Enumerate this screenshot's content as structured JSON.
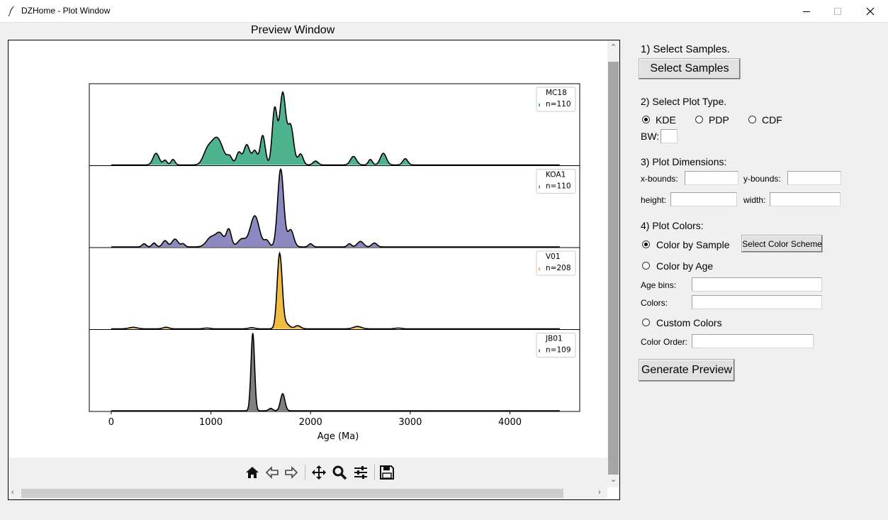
{
  "window": {
    "title": "DZHome - Plot Window"
  },
  "preview": {
    "label": "Preview Window"
  },
  "chart_data": {
    "type": "area",
    "xlabel": "Age (Ma)",
    "xlim": [
      -220,
      4700
    ],
    "xticks": [
      0,
      1000,
      2000,
      3000,
      4000
    ],
    "x_range": [
      0,
      4500
    ],
    "series": [
      {
        "name": "MC18",
        "n_label": "n=110",
        "color": "#4db38e",
        "peaks": [
          [
            450,
            0.15,
            30
          ],
          [
            540,
            0.06,
            20
          ],
          [
            620,
            0.07,
            20
          ],
          [
            960,
            0.14,
            40
          ],
          [
            1060,
            0.35,
            60
          ],
          [
            1190,
            0.09,
            25
          ],
          [
            1280,
            0.16,
            25
          ],
          [
            1360,
            0.26,
            30
          ],
          [
            1440,
            0.18,
            25
          ],
          [
            1520,
            0.38,
            25
          ],
          [
            1640,
            0.72,
            25
          ],
          [
            1720,
            0.92,
            30
          ],
          [
            1800,
            0.5,
            30
          ],
          [
            1900,
            0.14,
            25
          ],
          [
            2050,
            0.05,
            25
          ],
          [
            2430,
            0.11,
            30
          ],
          [
            2600,
            0.07,
            20
          ],
          [
            2730,
            0.15,
            30
          ],
          [
            2950,
            0.08,
            25
          ]
        ]
      },
      {
        "name": "KOA1",
        "n_label": "n=110",
        "color": "#8c89c0",
        "peaks": [
          [
            330,
            0.04,
            20
          ],
          [
            430,
            0.05,
            20
          ],
          [
            540,
            0.08,
            25
          ],
          [
            640,
            0.1,
            30
          ],
          [
            720,
            0.04,
            20
          ],
          [
            1000,
            0.12,
            45
          ],
          [
            1090,
            0.17,
            40
          ],
          [
            1180,
            0.22,
            25
          ],
          [
            1310,
            0.1,
            40
          ],
          [
            1440,
            0.4,
            45
          ],
          [
            1560,
            0.08,
            25
          ],
          [
            1700,
            1.0,
            30
          ],
          [
            1800,
            0.22,
            30
          ],
          [
            2000,
            0.04,
            20
          ],
          [
            2390,
            0.04,
            20
          ],
          [
            2500,
            0.07,
            30
          ],
          [
            2640,
            0.05,
            25
          ]
        ]
      },
      {
        "name": "V01",
        "n_label": "n=208",
        "color": "#f0bd44",
        "peaks": [
          [
            220,
            0.02,
            40
          ],
          [
            550,
            0.02,
            30
          ],
          [
            960,
            0.01,
            30
          ],
          [
            1410,
            0.015,
            30
          ],
          [
            1690,
            0.97,
            25
          ],
          [
            1760,
            0.06,
            30
          ],
          [
            1870,
            0.04,
            30
          ],
          [
            2470,
            0.03,
            40
          ],
          [
            2880,
            0.01,
            30
          ]
        ]
      },
      {
        "name": "JB01",
        "n_label": "n=109",
        "color": "#808080",
        "peaks": [
          [
            1420,
            1.0,
            18
          ],
          [
            1600,
            0.03,
            20
          ],
          [
            1720,
            0.22,
            22
          ]
        ]
      }
    ]
  },
  "toolbar": {
    "icons": [
      "home-icon",
      "back-icon",
      "forward-icon",
      "pan-icon",
      "zoom-icon",
      "configure-icon",
      "save-icon"
    ]
  },
  "panel": {
    "step1": "1) Select Samples.",
    "select_samples_button": "Select Samples",
    "step2": "2) Select Plot Type.",
    "plot_types": [
      "KDE",
      "PDP",
      "CDF"
    ],
    "selected_plot_type": "KDE",
    "bw_label": "BW:",
    "step3": "3) Plot Dimensions:",
    "xbounds_label": "x-bounds:",
    "ybounds_label": "y-bounds:",
    "height_label": "height:",
    "width_label": "width:",
    "step4": "4) Plot Colors:",
    "color_by_sample": "Color by Sample",
    "select_color_scheme": "Select Color Scheme",
    "color_by_age": "Color by Age",
    "age_bins_label": "Age bins:",
    "colors_label": "Colors:",
    "custom_colors": "Custom Colors",
    "color_order_label": "Color Order:",
    "generate_preview": "Generate Preview"
  }
}
